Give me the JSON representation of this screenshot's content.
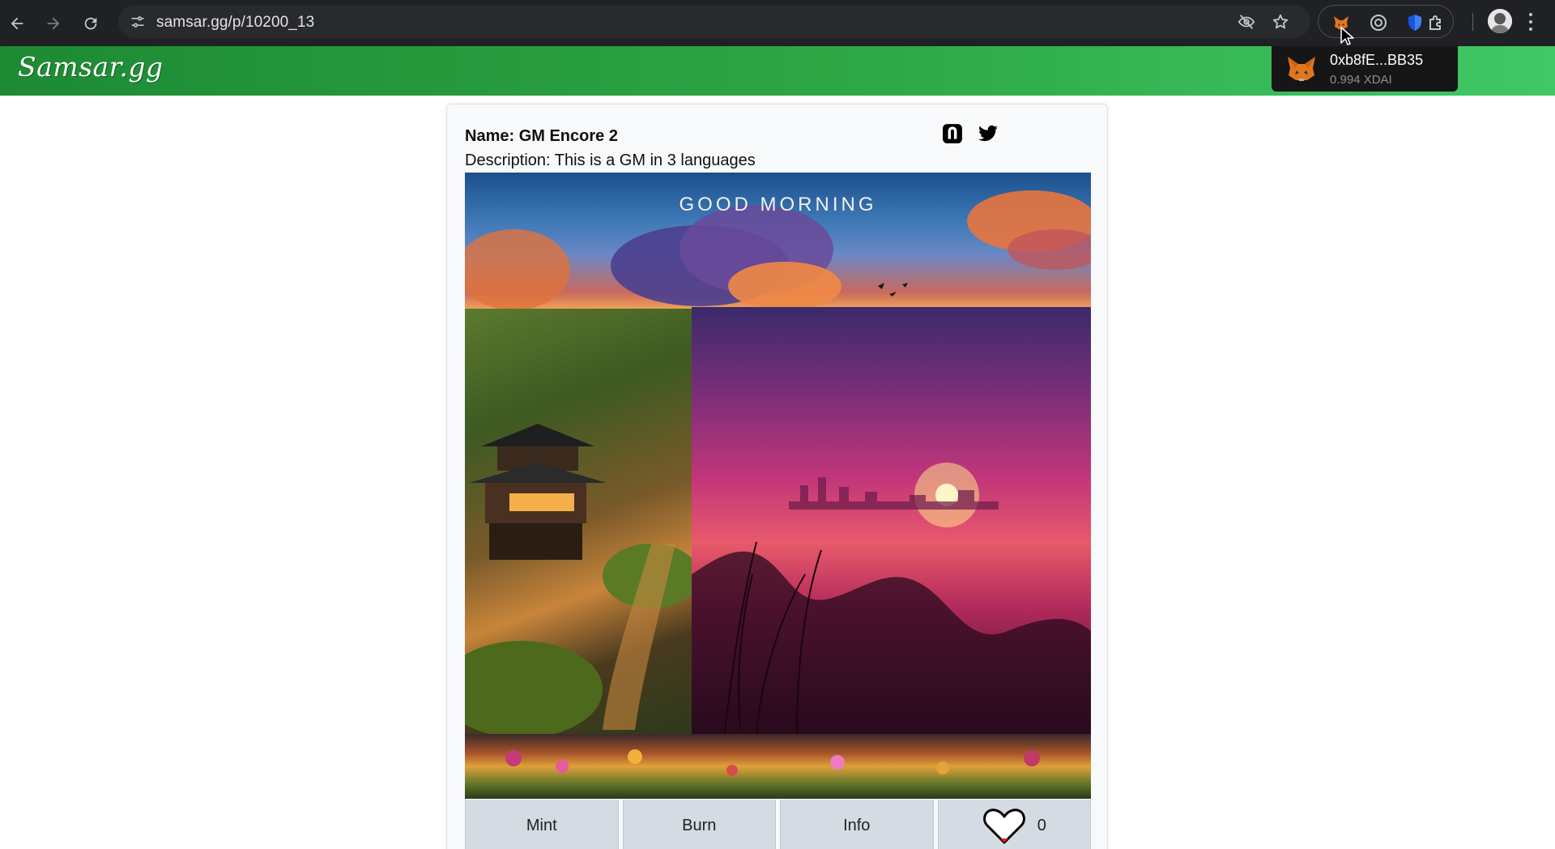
{
  "browser": {
    "url": "samsar.gg/p/10200_13"
  },
  "site": {
    "logo_text": "Samsar.gg"
  },
  "wallet": {
    "address": "0xb8fE...BB35",
    "balance": "0.994 XDAI"
  },
  "nft": {
    "name": "Name: GM Encore 2",
    "description": "Description: This is a GM in 3 languages",
    "image_caption": "GOOD MORNING"
  },
  "actions": {
    "mint_label": "Mint",
    "burn_label": "Burn",
    "info_label": "Info",
    "like_count": "0"
  },
  "colors": {
    "header_start": "#1d8a34",
    "header_end": "#40c866",
    "button_bg": "#d4dbe2"
  },
  "icons": {
    "back": "back-arrow-icon",
    "forward": "forward-arrow-icon",
    "reload": "reload-icon",
    "site_info": "tune-icon",
    "eye_off": "eye-off-icon",
    "bookmark": "star-icon",
    "metamask": "fox-icon",
    "shield": "shield-icon",
    "extensions": "puzzle-icon",
    "marketplace": "n-logo-icon",
    "twitter": "twitter-bird-icon",
    "like": "heart-icon"
  }
}
